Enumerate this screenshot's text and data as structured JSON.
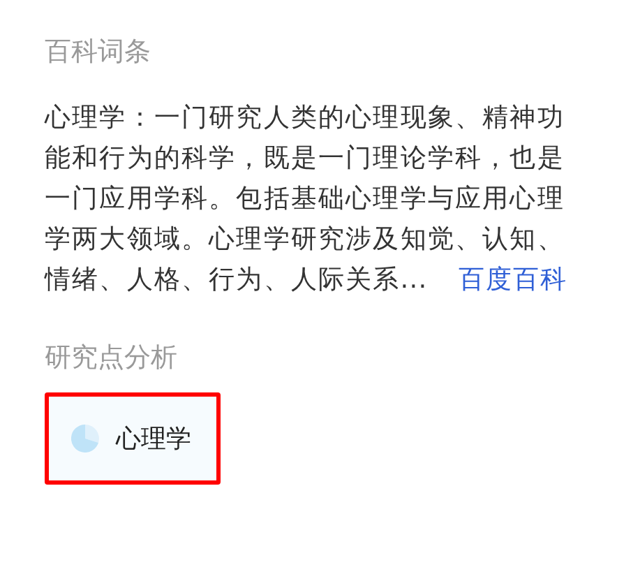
{
  "encyclopedia": {
    "heading": "百科词条",
    "summary": "心理学：一门研究人类的心理现象、精神功能和行为的科学，既是一门理论学科，也是一门应用学科。包括基础心理学与应用心理学两大领域。心理学研究涉及知觉、认知、情绪、人格、行为、人际关系...",
    "source_link": "百度百科"
  },
  "analysis": {
    "heading": "研究点分析",
    "topics": [
      {
        "label": "心理学",
        "highlighted": true
      }
    ]
  }
}
